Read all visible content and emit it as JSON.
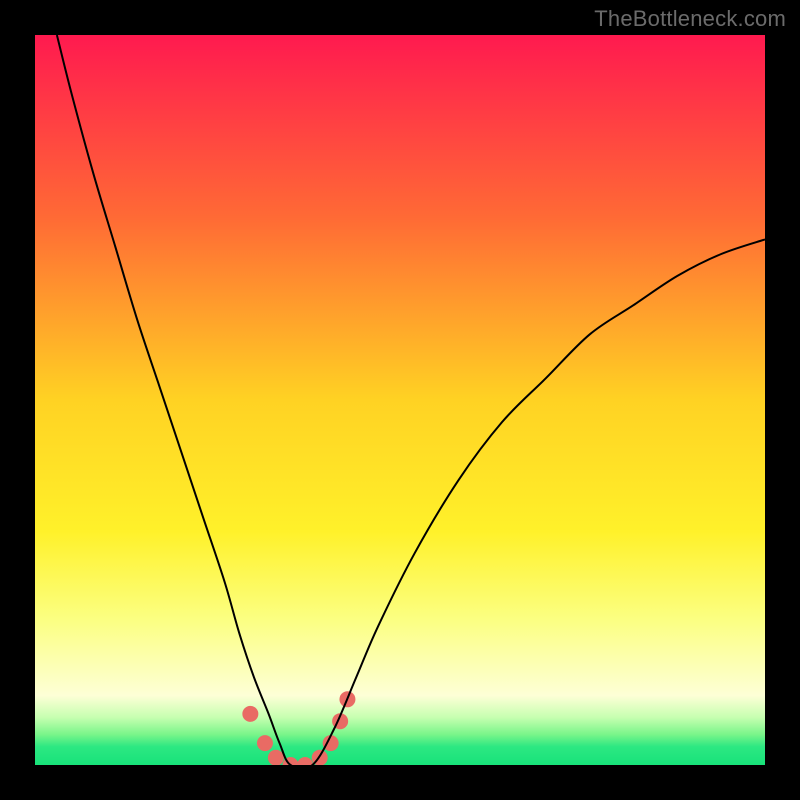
{
  "watermark": "TheBottleneck.com",
  "chart_data": {
    "type": "line",
    "title": "",
    "xlabel": "",
    "ylabel": "",
    "xlim": [
      0,
      100
    ],
    "ylim": [
      0,
      100
    ],
    "grid": false,
    "legend": false,
    "annotations": [],
    "gradient_stops": [
      {
        "pos": 0.0,
        "color": "#ff1a4f"
      },
      {
        "pos": 0.25,
        "color": "#ff6a35"
      },
      {
        "pos": 0.5,
        "color": "#ffd223"
      },
      {
        "pos": 0.68,
        "color": "#fff12a"
      },
      {
        "pos": 0.8,
        "color": "#fbff81"
      },
      {
        "pos": 0.905,
        "color": "#fdffd6"
      },
      {
        "pos": 0.935,
        "color": "#c6ffb0"
      },
      {
        "pos": 0.958,
        "color": "#7af58a"
      },
      {
        "pos": 0.975,
        "color": "#2ce882"
      },
      {
        "pos": 1.0,
        "color": "#18e27a"
      }
    ],
    "series": [
      {
        "name": "bottleneck-curve",
        "color": "#000000",
        "stroke_width": 2,
        "x": [
          3,
          5,
          8,
          11,
          14,
          17,
          20,
          23,
          26,
          28,
          30,
          32,
          33.5,
          35,
          38,
          41,
          44,
          47,
          52,
          58,
          64,
          70,
          76,
          82,
          88,
          94,
          100
        ],
        "y": [
          100,
          92,
          81,
          71,
          61,
          52,
          43,
          34,
          25,
          18,
          12,
          7,
          3,
          0,
          0,
          5,
          12,
          19,
          29,
          39,
          47,
          53,
          59,
          63,
          67,
          70,
          72
        ]
      }
    ],
    "markers": {
      "name": "highlight-points",
      "color": "#e96b64",
      "radius": 8,
      "x": [
        29.5,
        31.5,
        33,
        35,
        37,
        39,
        40.5,
        41.8,
        42.8
      ],
      "y": [
        7,
        3,
        1,
        0,
        0,
        1,
        3,
        6,
        9
      ]
    }
  }
}
